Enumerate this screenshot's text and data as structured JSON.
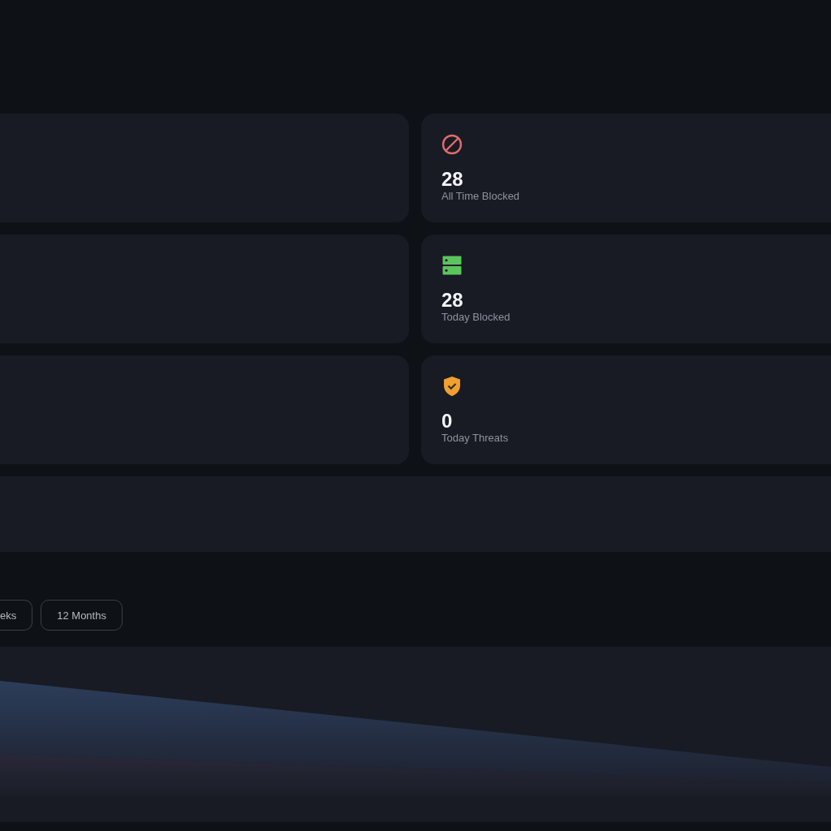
{
  "stats": [
    {
      "kind": "ban",
      "color": "#e06c6c",
      "value": "28",
      "label": "All Time Blocked"
    },
    {
      "kind": "server",
      "color": "#5cc45c",
      "value": "28",
      "label": "Today Blocked"
    },
    {
      "kind": "shield",
      "color": "#f0a030",
      "value": "0",
      "label": "Today Threats"
    }
  ],
  "ranges": [
    {
      "label": "eks",
      "selected": false
    },
    {
      "label": "12 Months",
      "selected": false
    }
  ]
}
